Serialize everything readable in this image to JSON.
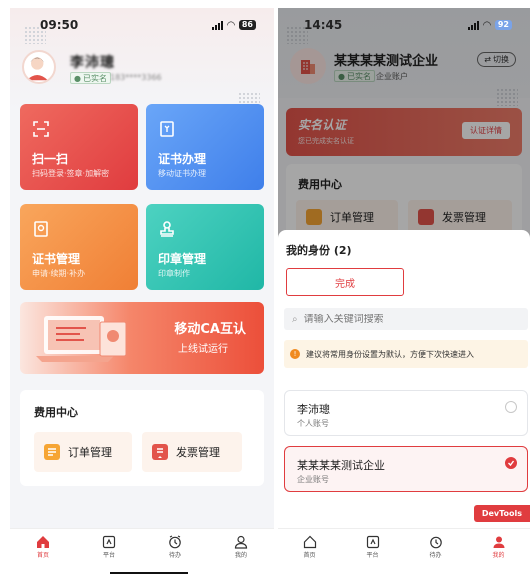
{
  "left": {
    "status": {
      "time": "09:50",
      "battery": "86"
    },
    "user": {
      "name": "李沛璁",
      "verified_tag": "已实名",
      "masked_id": "183****3366"
    },
    "tiles": [
      {
        "title": "扫一扫",
        "subtitle": "扫码登录·签章·加解密"
      },
      {
        "title": "证书办理",
        "subtitle": "移动证书办理"
      },
      {
        "title": "证书管理",
        "subtitle": "申请·续期·补办"
      },
      {
        "title": "印章管理",
        "subtitle": "印章制作"
      }
    ],
    "banner": {
      "title": "移动CA互认",
      "subtitle": "上线试运行"
    },
    "fee_center": {
      "title": "费用中心",
      "orders": "订单管理",
      "invoices": "发票管理"
    }
  },
  "right": {
    "status": {
      "time": "14:45",
      "battery": "92"
    },
    "org": {
      "name": "某某某某测试企业",
      "switch_label": "切换",
      "verified_tag": "已实名",
      "account_type": "企业账户"
    },
    "verify": {
      "title": "实名认证",
      "subtitle": "您已完成实名认证",
      "button": "认证详情"
    },
    "fee_center": {
      "title": "费用中心",
      "orders": "订单管理",
      "invoices": "发票管理"
    },
    "sheet": {
      "title": "我的身份 (2)",
      "done_button": "完成",
      "search_placeholder": "请输入关键词搜索",
      "notice": "建议将常用身份设置为默认，方便下次快速进入",
      "identities": [
        {
          "name": "李沛璁",
          "type": "个人账号",
          "selected": false
        },
        {
          "name": "某某某某测试企业",
          "type": "企业账号",
          "selected": true
        }
      ]
    },
    "devtools_label": "DevTools"
  },
  "tabbar": [
    "首页",
    "平台",
    "待办",
    "我的"
  ],
  "colors": {
    "accent": "#e03c3f",
    "blue": "#3f7fea",
    "orange": "#f07f35",
    "teal": "#20b7a6"
  }
}
